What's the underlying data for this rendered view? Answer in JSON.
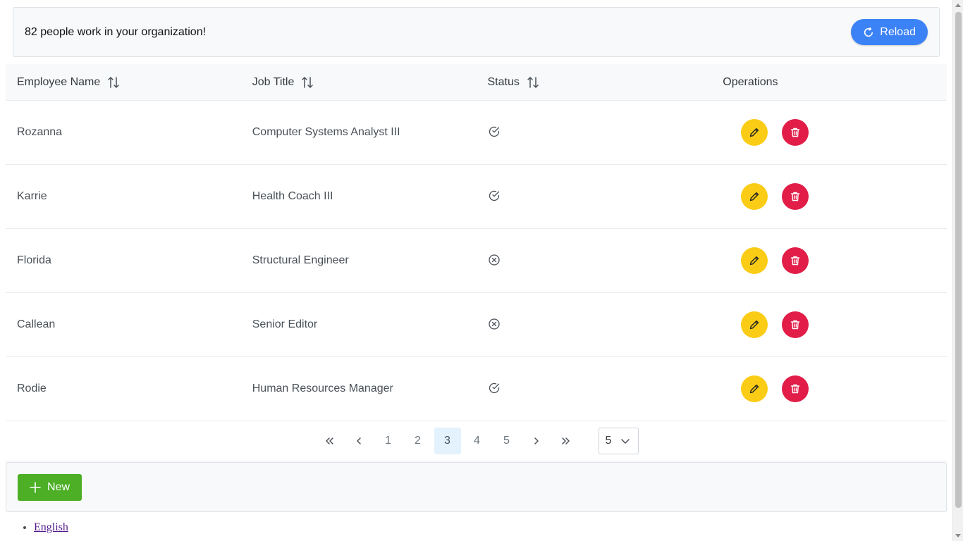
{
  "header": {
    "message": "82 people work in your organization!",
    "reload_label": "Reload"
  },
  "table": {
    "columns": [
      {
        "label": "Employee Name",
        "sortable": true
      },
      {
        "label": "Job Title",
        "sortable": true
      },
      {
        "label": "Status",
        "sortable": true
      },
      {
        "label": "Operations",
        "sortable": false
      }
    ],
    "rows": [
      {
        "name": "Rozanna",
        "title": "Computer Systems Analyst III",
        "status": "check-circle-icon"
      },
      {
        "name": "Karrie",
        "title": "Health Coach III",
        "status": "check-circle-icon"
      },
      {
        "name": "Florida",
        "title": "Structural Engineer",
        "status": "x-circle-icon"
      },
      {
        "name": "Callean",
        "title": "Senior Editor",
        "status": "x-circle-icon"
      },
      {
        "name": "Rodie",
        "title": "Human Resources Manager",
        "status": "check-circle-icon"
      }
    ]
  },
  "paginator": {
    "pages": [
      "1",
      "2",
      "3",
      "4",
      "5"
    ],
    "current_page": "3",
    "rows_per_page": "5"
  },
  "toolbar": {
    "new_label": "New"
  },
  "languages": [
    "English"
  ],
  "colors": {
    "reload": "#3b82f6",
    "edit": "#facc15",
    "delete": "#e11d48",
    "new": "#4caf26",
    "active_page": "#e3f2fd"
  }
}
